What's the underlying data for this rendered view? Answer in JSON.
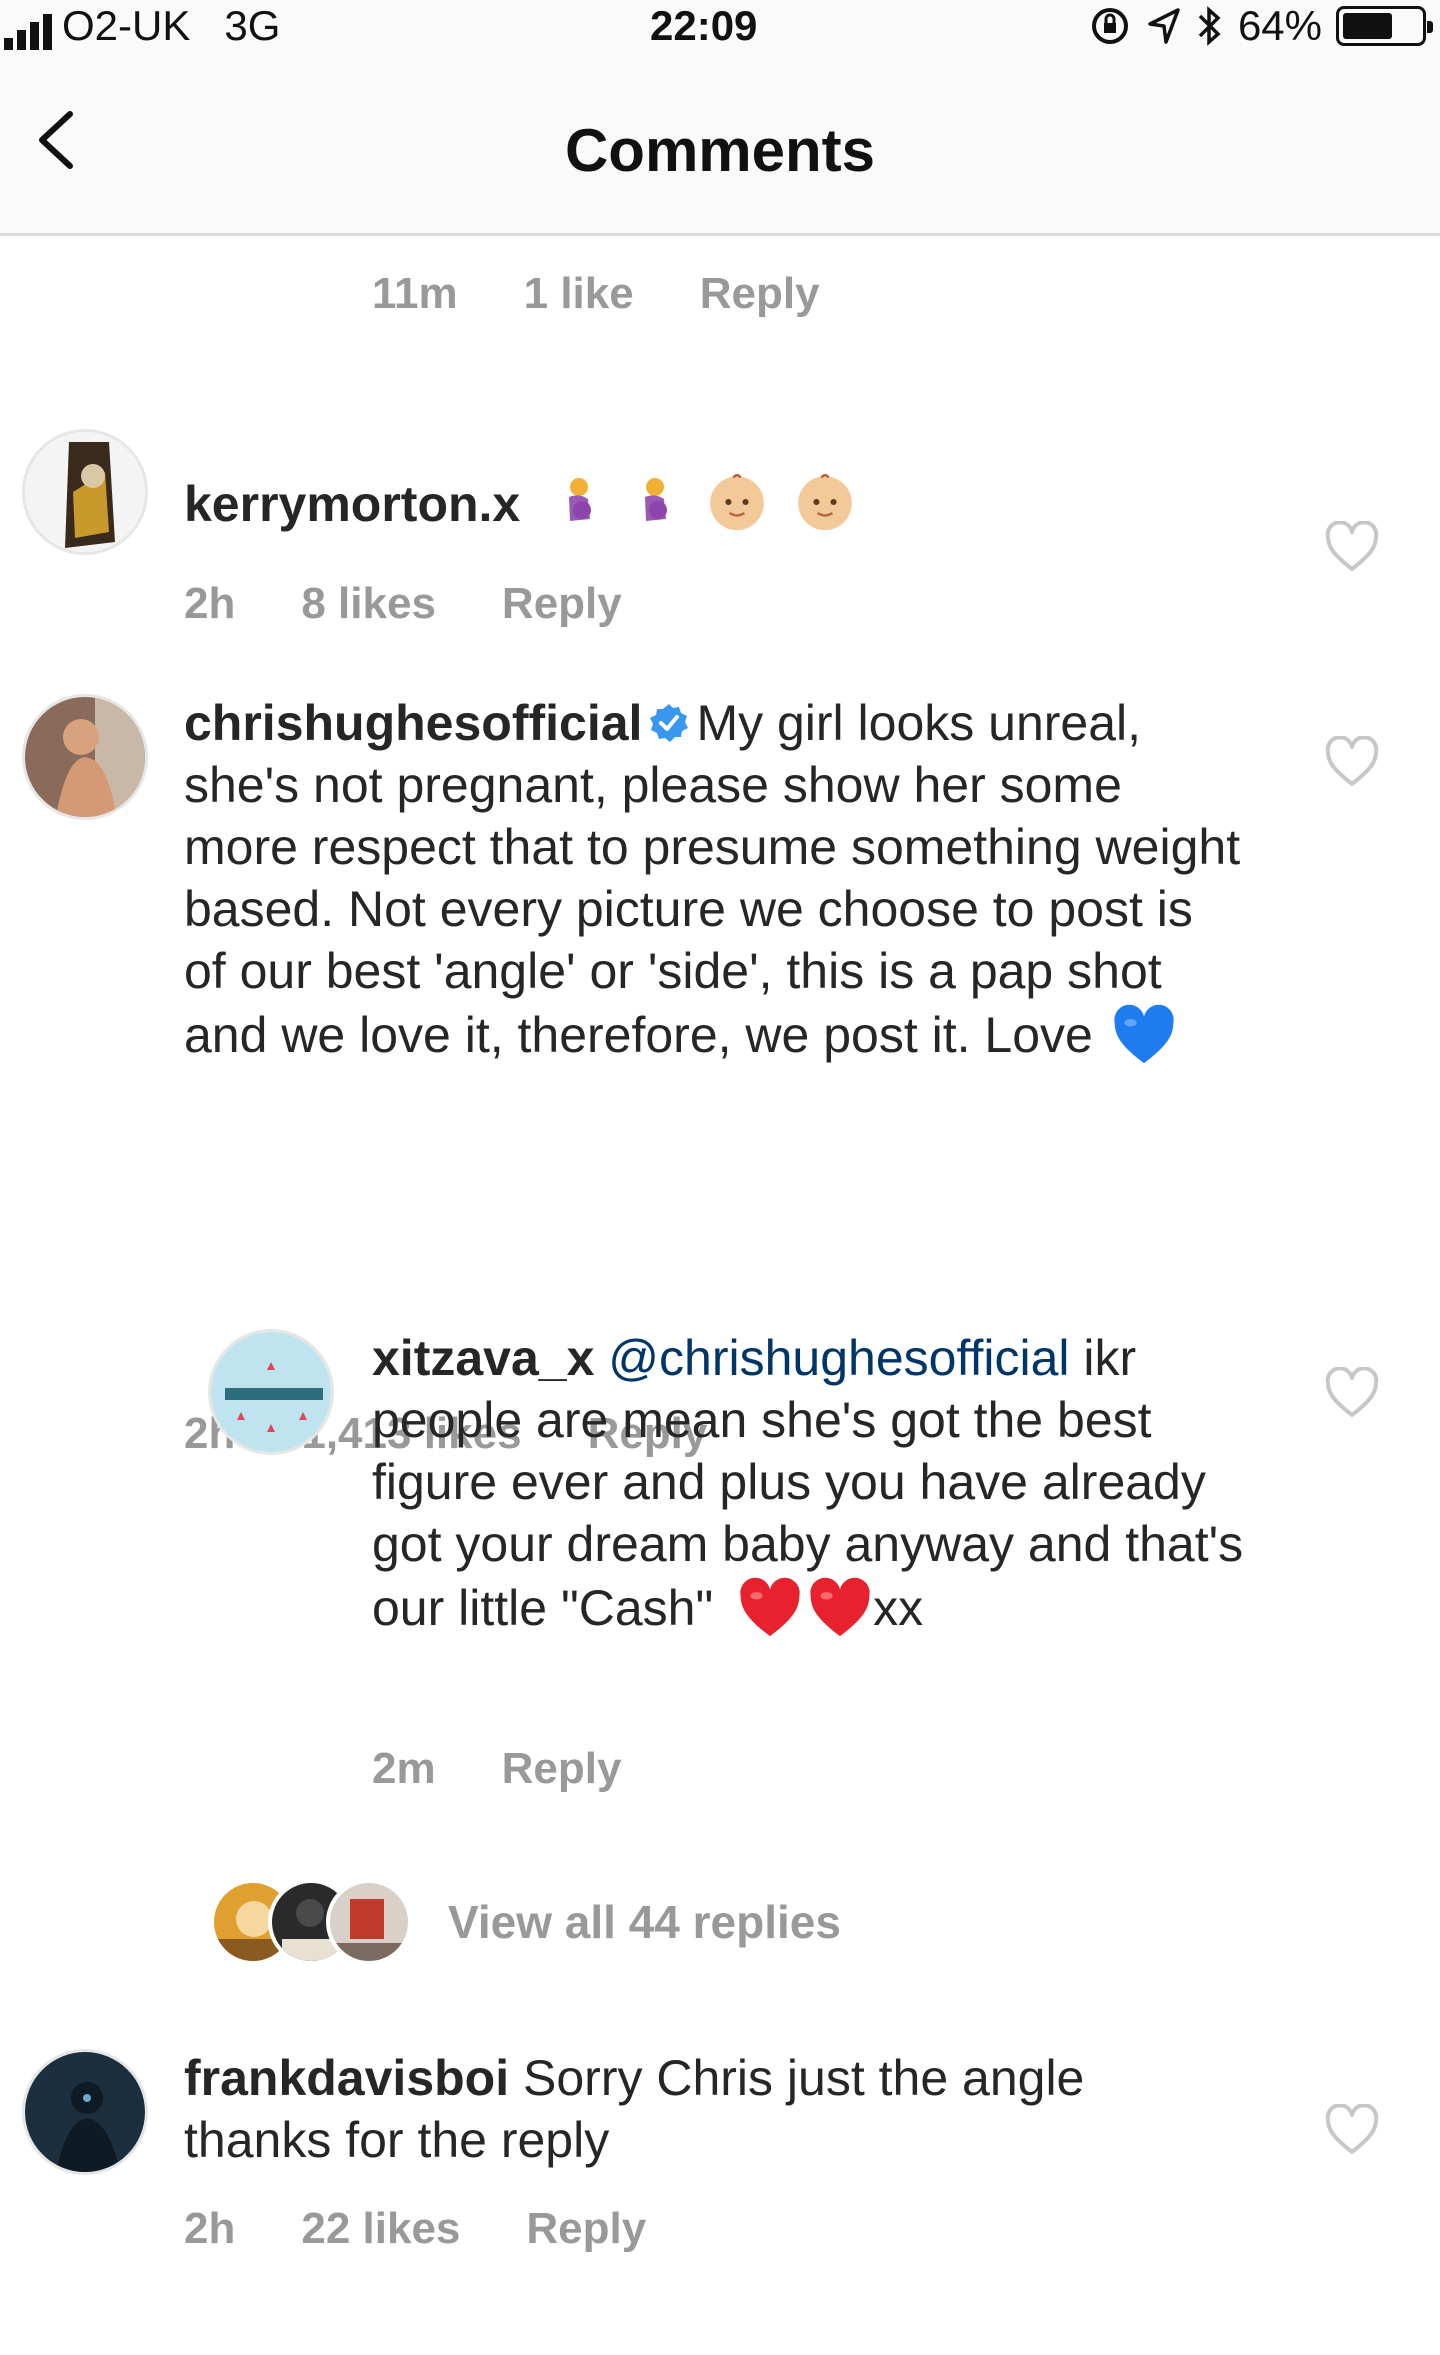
{
  "status_bar": {
    "carrier": "O2-UK",
    "network": "3G",
    "time": "22:09",
    "battery": "64%",
    "icons": [
      "signal-icon",
      "orientation-lock-icon",
      "location-icon",
      "bluetooth-icon",
      "battery-icon"
    ]
  },
  "header": {
    "title": "Comments",
    "back_icon": "chevron-left-icon"
  },
  "previous_comment_meta": {
    "time": "11m",
    "likes": "1 like",
    "reply": "Reply"
  },
  "comments": [
    {
      "username": "kerrymorton.x",
      "text": "",
      "emojis": [
        "pregnant-woman-emoji",
        "pregnant-woman-emoji",
        "baby-emoji",
        "baby-emoji"
      ],
      "time": "2h",
      "likes": "8 likes",
      "reply": "Reply"
    },
    {
      "username": "chrishughesofficial",
      "verified": true,
      "text": "My girl looks unreal, she's not pregnant, please show her some more respect that to presume something weight based. Not every picture we choose to post is of our best 'angle' or 'side', this is a pap shot and we love it, therefore, we post it. Love",
      "emojis": [
        "blue-heart-emoji"
      ],
      "time": "2h",
      "likes": "1,413 likes",
      "reply": "Reply"
    },
    {
      "username": "xitzava_x",
      "mention": "@chrishughesofficial",
      "text": "ikr people are mean she's got the best figure ever and plus you have already got your dream baby anyway and that's our little \"Cash\"",
      "emojis": [
        "red-heart-emoji",
        "red-heart-emoji"
      ],
      "text_after_emoji": "xx",
      "time": "2m",
      "reply": "Reply"
    },
    {
      "username": "frankdavisboi",
      "text": "Sorry Chris just the angle thanks for the reply",
      "time": "2h",
      "likes": "22 likes",
      "reply": "Reply"
    }
  ],
  "view_replies": {
    "label": "View all 44 replies"
  },
  "colors": {
    "meta_gray": "#999999",
    "mention_blue": "#003569",
    "verified_blue": "#3897f0",
    "heart_outline": "#c7c7c7"
  }
}
